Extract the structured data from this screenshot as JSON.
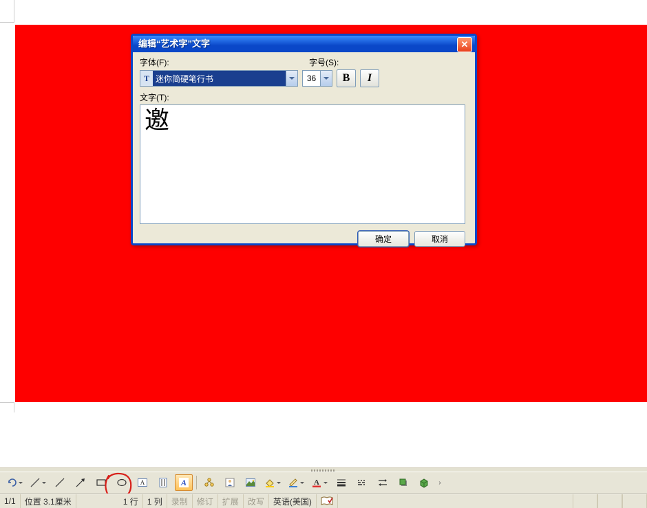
{
  "dialog": {
    "title": "编辑“艺术字”文字",
    "labels": {
      "font": "字体(F):",
      "size": "字号(S):",
      "text": "文字(T):"
    },
    "font_value": "迷你简硬笔行书",
    "size_value": "36",
    "text_value": "邀",
    "ok": "确定",
    "cancel": "取消"
  },
  "toolbar": {
    "items": [
      "undo-dd",
      "autoshapes-dd",
      "line",
      "arrow",
      "rectangle",
      "oval",
      "textbox",
      "vertical-textbox",
      "wordart",
      "diagram",
      "clipart",
      "picture",
      "fill-color-dd",
      "line-color-dd",
      "font-color-dd",
      "line-weight",
      "dash-style",
      "arrow-style",
      "shadow",
      "3d",
      "more"
    ]
  },
  "status": {
    "page": "1/1",
    "position_label": "位置",
    "position_value": "3.1厘米",
    "line_label": "1 行",
    "col_label": "1 列",
    "rec": "录制",
    "trk": "修订",
    "ext": "扩展",
    "ovr": "改写",
    "lang": "英语(美国)"
  }
}
